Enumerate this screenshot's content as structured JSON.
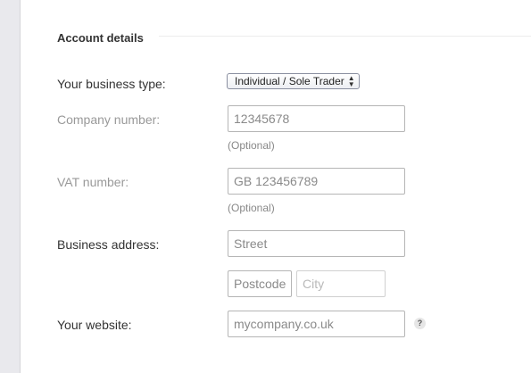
{
  "section": {
    "title": "Account details"
  },
  "business_type": {
    "label": "Your business type:",
    "selected": "Individual / Sole Trader"
  },
  "company_number": {
    "label": "Company number:",
    "placeholder": "12345678",
    "hint": "(Optional)"
  },
  "vat_number": {
    "label": "VAT number:",
    "placeholder": "GB 123456789",
    "hint": "(Optional)"
  },
  "business_address": {
    "label": "Business address:",
    "street_placeholder": "Street",
    "postcode_placeholder": "Postcode",
    "city_placeholder": "City"
  },
  "website": {
    "label": "Your website:",
    "placeholder": "mycompany.co.uk",
    "help": "?"
  }
}
